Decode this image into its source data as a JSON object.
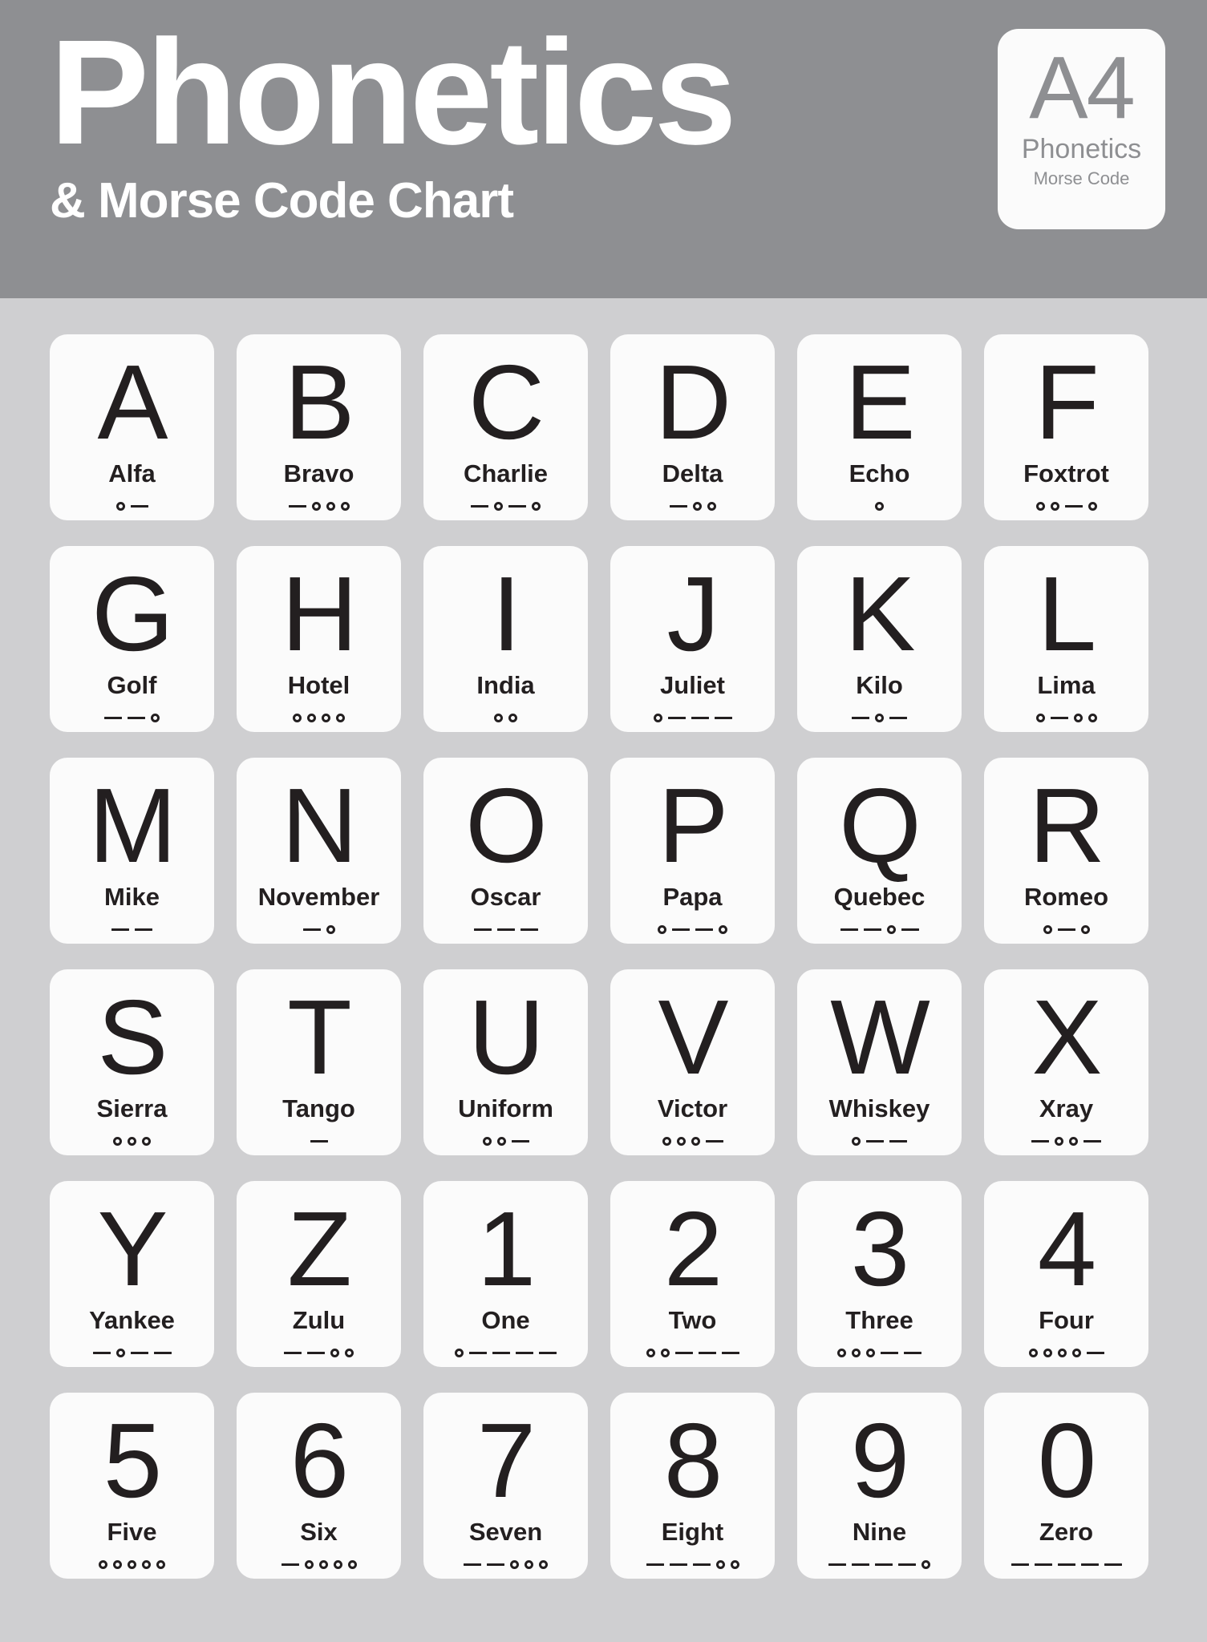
{
  "header": {
    "title": "Phonetics",
    "subtitle": "& Morse Code Chart",
    "background_color": "#8e8f92",
    "text_color": "#ffffff",
    "badge": {
      "code": "A4",
      "line1": "Phonetics",
      "line2": "Morse Code",
      "background_color": "#fbfbfb",
      "text_color": "#8e8f92"
    }
  },
  "page": {
    "background_color": "#cfcfd1",
    "card_color": "#fbfbfb",
    "ink_color": "#231f20"
  },
  "legend": {
    "dot_symbol": "○",
    "dash_symbol": "—"
  },
  "chart_data": {
    "type": "table",
    "title": "Phonetics & Morse Code Chart",
    "columns": [
      "character",
      "word",
      "morse"
    ],
    "columns_per_row": 6,
    "rows": [
      {
        "character": "A",
        "word": "Alfa",
        "morse": ".-"
      },
      {
        "character": "B",
        "word": "Bravo",
        "morse": "-..."
      },
      {
        "character": "C",
        "word": "Charlie",
        "morse": "-.-."
      },
      {
        "character": "D",
        "word": "Delta",
        "morse": "-.."
      },
      {
        "character": "E",
        "word": "Echo",
        "morse": "."
      },
      {
        "character": "F",
        "word": "Foxtrot",
        "morse": "..-."
      },
      {
        "character": "G",
        "word": "Golf",
        "morse": "--."
      },
      {
        "character": "H",
        "word": "Hotel",
        "morse": "...."
      },
      {
        "character": "I",
        "word": "India",
        "morse": ".."
      },
      {
        "character": "J",
        "word": "Juliet",
        "morse": ".---"
      },
      {
        "character": "K",
        "word": "Kilo",
        "morse": "-.-"
      },
      {
        "character": "L",
        "word": "Lima",
        "morse": ".-.."
      },
      {
        "character": "M",
        "word": "Mike",
        "morse": "--"
      },
      {
        "character": "N",
        "word": "November",
        "morse": "-."
      },
      {
        "character": "O",
        "word": "Oscar",
        "morse": "---"
      },
      {
        "character": "P",
        "word": "Papa",
        "morse": ".--."
      },
      {
        "character": "Q",
        "word": "Quebec",
        "morse": "--.-"
      },
      {
        "character": "R",
        "word": "Romeo",
        "morse": ".-."
      },
      {
        "character": "S",
        "word": "Sierra",
        "morse": "..."
      },
      {
        "character": "T",
        "word": "Tango",
        "morse": "-"
      },
      {
        "character": "U",
        "word": "Uniform",
        "morse": "..-"
      },
      {
        "character": "V",
        "word": "Victor",
        "morse": "...-"
      },
      {
        "character": "W",
        "word": "Whiskey",
        "morse": ".--"
      },
      {
        "character": "X",
        "word": "Xray",
        "morse": "-..-"
      },
      {
        "character": "Y",
        "word": "Yankee",
        "morse": "-.--"
      },
      {
        "character": "Z",
        "word": "Zulu",
        "morse": "--.."
      },
      {
        "character": "1",
        "word": "One",
        "morse": ".----"
      },
      {
        "character": "2",
        "word": "Two",
        "morse": "..---"
      },
      {
        "character": "3",
        "word": "Three",
        "morse": "...--"
      },
      {
        "character": "4",
        "word": "Four",
        "morse": "....-"
      },
      {
        "character": "5",
        "word": "Five",
        "morse": "....."
      },
      {
        "character": "6",
        "word": "Six",
        "morse": "-...."
      },
      {
        "character": "7",
        "word": "Seven",
        "morse": "--..."
      },
      {
        "character": "8",
        "word": "Eight",
        "morse": "---.."
      },
      {
        "character": "9",
        "word": "Nine",
        "morse": "----."
      },
      {
        "character": "0",
        "word": "Zero",
        "morse": "-----"
      }
    ]
  }
}
